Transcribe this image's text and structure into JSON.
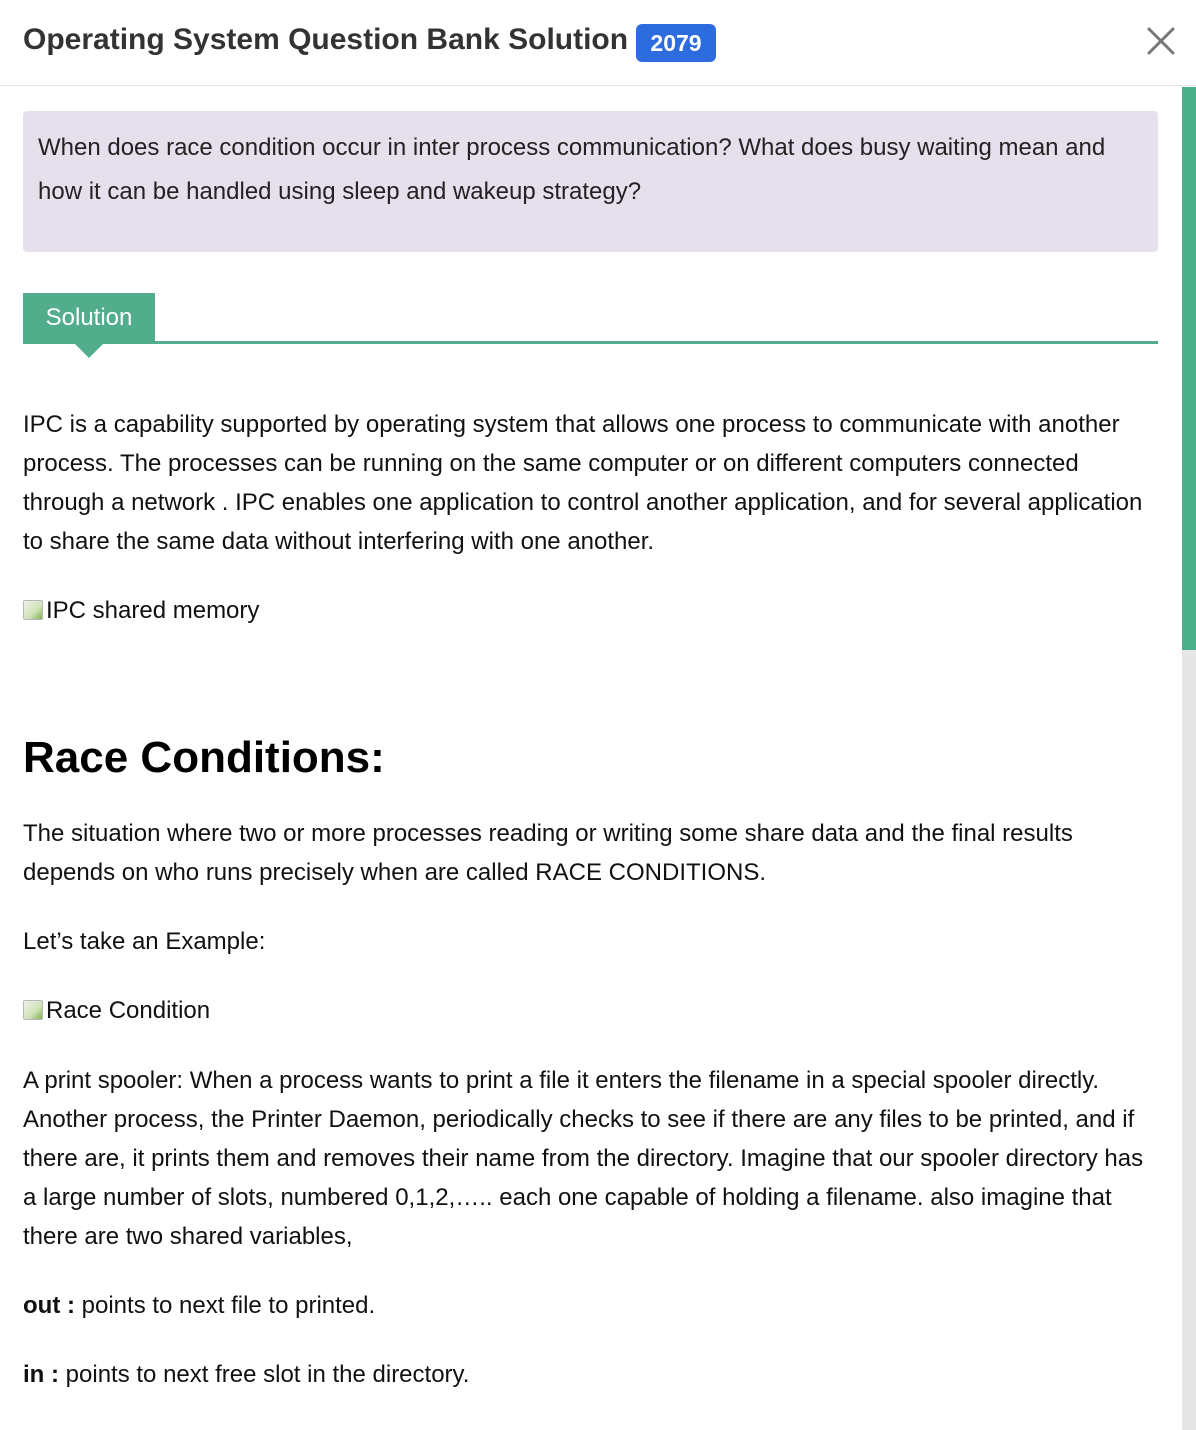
{
  "header": {
    "title": "Operating System Question Bank Solution",
    "year_badge": "2079",
    "close_icon": "close-x"
  },
  "question": {
    "text": "When does race condition occur in inter process communication? What does busy waiting mean and how it can be handled using sleep and wakeup strategy?"
  },
  "solution_tab": {
    "label": "Solution"
  },
  "content": {
    "intro_paragraph": "IPC is a capability supported by operating system that allows one process to communicate with another process. The processes can be running on the same computer or on different computers connected through a network . IPC enables one application to control another application, and for several application to share the same data without interfering with one another.",
    "image1_alt": "IPC shared memory",
    "race_heading": "Race Conditions:",
    "race_definition": "The situation where two or more processes reading or writing some share data and the final results depends on who runs precisely when are called RACE CONDITIONS.",
    "example_intro": "Let’s take an Example:",
    "image2_alt": "Race Condition",
    "spooler_paragraph": "A print spooler: When a process wants to print a file it enters the filename in a special spooler directly. Another process, the Printer Daemon, periodically checks to see if there are any files to be printed, and if there are, it prints them and removes their name from the directory. Imagine that our spooler directory has a large number of slots, numbered 0,1,2,….. each one capable of holding a filename. also imagine that there are two shared variables,",
    "out_label": "out :",
    "out_text": " points to next file to printed.",
    "in_label": "in :",
    "in_text": " points to next free slot in the directory."
  },
  "colors": {
    "badge": "#2d6cdf",
    "accent": "#52ad8c",
    "question_bg": "#e6dfec",
    "scroll_thumb": "#4caf8c"
  },
  "scroll": {
    "thumb_fraction": 0.42
  }
}
